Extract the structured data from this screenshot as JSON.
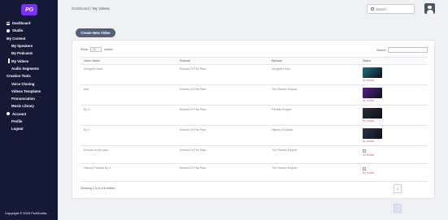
{
  "app": {
    "logo_text": "PG",
    "brand_color": "#7b2ff7"
  },
  "sidebar": {
    "items": [
      {
        "label": "Dashboard",
        "level": "top",
        "icon": "grid-icon"
      },
      {
        "label": "Studio",
        "level": "top",
        "icon": "circle-icon"
      },
      {
        "label": "My Content",
        "level": "top-plain"
      },
      {
        "label": "My Speakers",
        "level": "sub"
      },
      {
        "label": "My Podcasts",
        "level": "sub"
      },
      {
        "label": "My Videos",
        "level": "sub",
        "active": true
      },
      {
        "label": "Audio Segments",
        "level": "sub"
      },
      {
        "label": "Creation Tools",
        "level": "top-plain"
      },
      {
        "label": "Voice Cloning",
        "level": "sub"
      },
      {
        "label": "Videos Templates",
        "level": "sub"
      },
      {
        "label": "Pronunciation",
        "level": "sub"
      },
      {
        "label": "Music Library",
        "level": "sub"
      },
      {
        "label": "Account",
        "level": "top",
        "icon": "circle-icon"
      },
      {
        "label": "Profile",
        "level": "sub"
      },
      {
        "label": "Logout",
        "level": "sub"
      }
    ],
    "copyright": "Copyright © 2023 PodGorilla."
  },
  "header": {
    "breadcrumb_root": "Dashboard",
    "breadcrumb_sep": "/",
    "breadcrumb_current": "My Videos",
    "search_placeholder": "Search"
  },
  "create_button": "Create New Video",
  "table_controls": {
    "show_label": "Show",
    "entries_value": "10",
    "entries_label": "entries",
    "search_label": "Search:"
  },
  "table": {
    "headers": [
      "Video Name",
      "Podcast",
      "Episode",
      "Status"
    ],
    "rows": [
      {
        "name": "Genghis Khan",
        "podcast": "Echoes Of The Past",
        "episode": "Genghis Khan",
        "thumb": "#1f6f86",
        "status": "No render"
      },
      {
        "name": "test",
        "podcast": "Echoes Of The Past",
        "episode": "The Roman Empire",
        "thumb": "#5a1f8a",
        "status": "No render"
      },
      {
        "name": "Ep 3",
        "podcast": "Echoes Of The Past",
        "episode": "Persian Empire",
        "thumb": "#2a2f3f",
        "status": "No render"
      },
      {
        "name": "Ep 2",
        "podcast": "Echoes Of The Past",
        "episode": "History Of Arabs",
        "thumb": "#2c3448",
        "status": "No render"
      },
      {
        "name": "Echoes of the past",
        "podcast": "Echoes Of The Past",
        "episode": "The Roman Empire",
        "thumb": null,
        "status": "No render"
      },
      {
        "name": "History Podcast Ep 1",
        "podcast": "Echoes Of The Past",
        "episode": "The Roman Empire",
        "thumb": null,
        "status": "No render"
      }
    ]
  },
  "footer": {
    "info": "Showing 1 to 6 of 6 entries",
    "prev": "‹",
    "page": "1",
    "next": "›"
  }
}
